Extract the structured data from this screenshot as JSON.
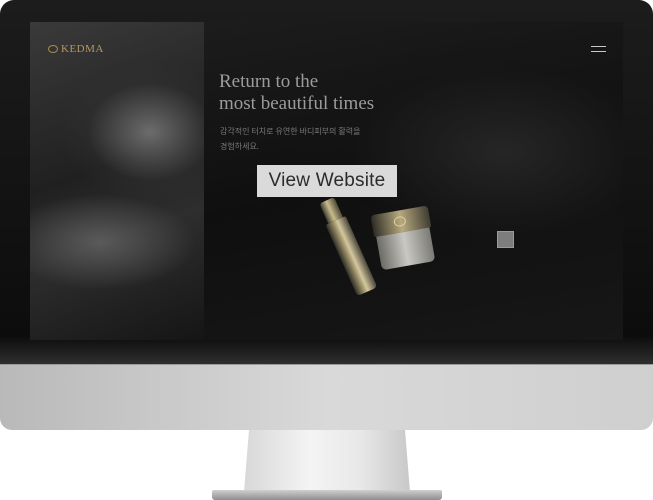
{
  "site": {
    "logo_text": "KEDMA",
    "headline_line1": "Return to the",
    "headline_line2": "most beautiful times",
    "subtext_line1": "감각적인 터치로 유연한 바디피부의 활력을",
    "subtext_line2": "경험하세요."
  },
  "overlay": {
    "view_website_label": "View Website"
  },
  "colors": {
    "accent_gold": "#b59862",
    "screen_bg": "#0a0a0a"
  },
  "icons": {
    "logo": "kedma-emblem-icon",
    "menu": "hamburger-menu-icon"
  }
}
